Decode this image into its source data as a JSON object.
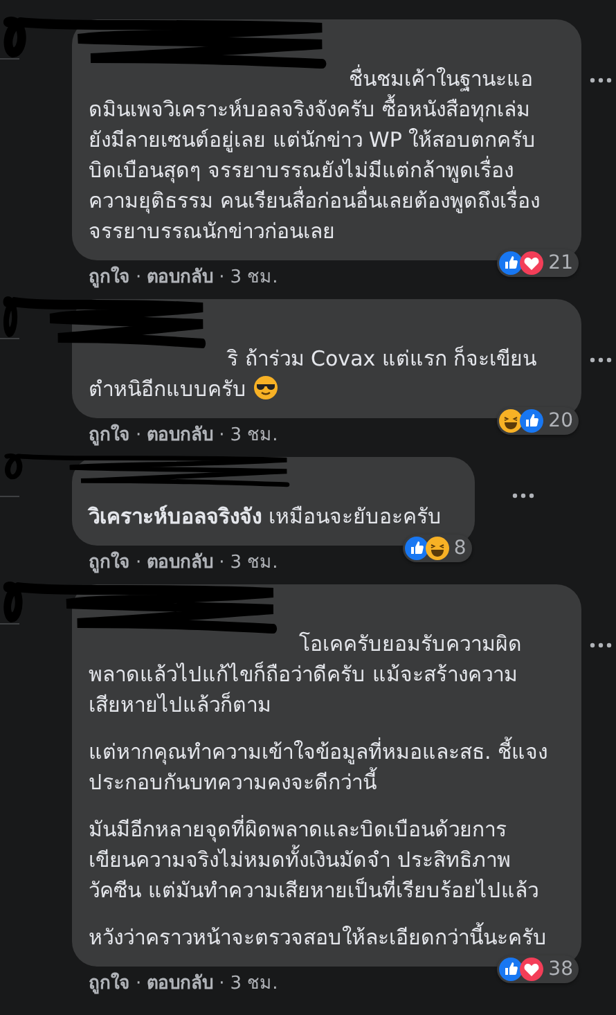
{
  "comments": [
    {
      "redacted": true,
      "paragraphs": [
        "ชื่นชมเค้าในฐานะแอดมินเพจวิเคราะห์บอลจริงจังครับ ซื้อหนังสือทุกเล่มยังมีลายเซนต์อยู่เลย แต่นักข่าว WP ให้สอบตกครับ บิดเบือนสุดๆ จรรยาบรรณยังไม่มีแต่กล้าพูดเรื่องความยุติธรรม คนเรียนสื่อก่อนอื่นเลยต้องพูดถึงเรื่องจรรยาบรรณนักข่าวก่อนเลย"
      ],
      "emoji_after": false,
      "reactions": [
        {
          "kind": "like"
        },
        {
          "kind": "love"
        }
      ],
      "reaction_count": "21",
      "actions": [
        "ถูกใจ",
        "ตอบกลับ"
      ],
      "separator": "·",
      "time": "3 ชม."
    },
    {
      "redacted": true,
      "paragraphs": [
        "ริ ถ้าร่วม Covax แต่แรก ก็จะเขียนตำหนิอีกแบบครับ"
      ],
      "emoji_after": true,
      "reactions": [
        {
          "kind": "haha"
        },
        {
          "kind": "like"
        }
      ],
      "reaction_count": "20",
      "actions": [
        "ถูกใจ",
        "ตอบกลับ"
      ],
      "separator": "·",
      "time": "3 ชม."
    },
    {
      "redacted": true,
      "paragraphs": [
        "**วิเคราะห์บอลจริงจัง** เหมือนจะยับอะครับ"
      ],
      "emoji_after": false,
      "reactions": [
        {
          "kind": "like"
        },
        {
          "kind": "haha"
        }
      ],
      "reaction_count": "8",
      "actions": [
        "ถูกใจ",
        "ตอบกลับ"
      ],
      "separator": "·",
      "time": "3 ชม."
    },
    {
      "redacted": true,
      "paragraphs": [
        "โอเคครับยอมรับความผิดพลาดแล้วไปแก้ไขก็ถือว่าดีครับ แม้จะสร้างความเสียหายไปแล้วก็ตาม",
        "แต่หากคุณทำความเข้าใจข้อมูลที่หมอและสธ. ชี้แจงประกอบกันบทความคงจะดีกว่านี้",
        "มันมีอีกหลายจุดที่ผิดพลาดและบิดเบือนด้วยการเขียนความจริงไม่หมดทั้งเงินมัดจำ ประสิทธิภาพวัคซีน แต่มันทำความเสียหายเป็นที่เรียบร้อยไปแล้ว",
        "หวังว่าคราวหน้าจะตรวจสอบให้ละเอียดกว่านี้นะครับ"
      ],
      "emoji_after": false,
      "reactions": [
        {
          "kind": "like"
        },
        {
          "kind": "love"
        }
      ],
      "reaction_count": "38",
      "actions": [
        "ถูกใจ",
        "ตอบกลับ"
      ],
      "separator": "·",
      "time": "3 ชม."
    }
  ]
}
